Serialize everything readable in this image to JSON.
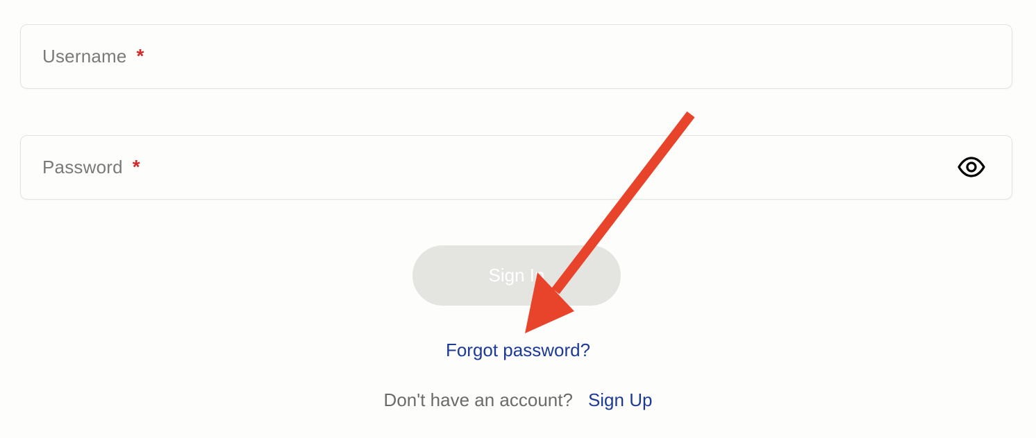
{
  "form": {
    "username": {
      "label": "Username",
      "required_marker": "*"
    },
    "password": {
      "label": "Password",
      "required_marker": "*",
      "toggle_icon": "eye-icon"
    },
    "sign_in_label": "Sign In",
    "forgot_password_label": "Forgot password?",
    "signup_prompt": "Don't have an account?",
    "signup_label": "Sign Up"
  },
  "annotation": {
    "type": "arrow",
    "color": "#e8442c"
  },
  "colors": {
    "link": "#1d3a96",
    "required": "#d12a2a",
    "button_disabled_bg": "#e4e4e1",
    "placeholder": "#7a7a7a"
  }
}
